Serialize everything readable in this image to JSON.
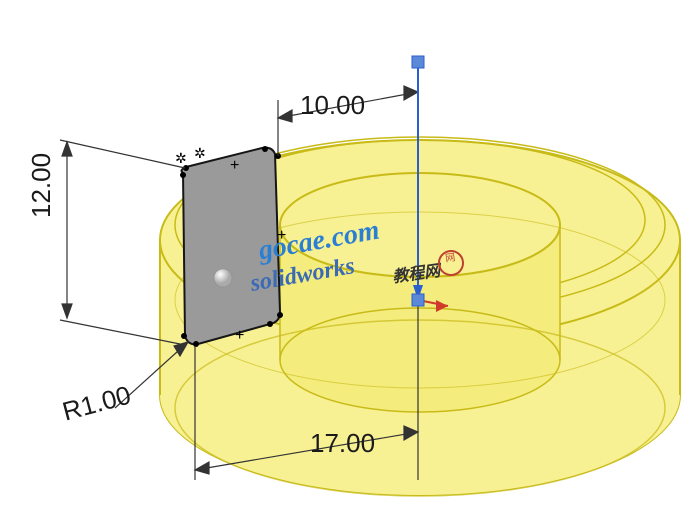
{
  "dimensions": {
    "width_top": "10.00",
    "height": "12.00",
    "radius": "R1.00",
    "width_bottom": "17.00"
  },
  "watermark": {
    "url": "gocae.com",
    "product": "solidworks",
    "cn": "教程网"
  },
  "colors": {
    "ring_fill": "#f8f193",
    "ring_edge": "#c8bb18",
    "sketch_fill": "#9a9a9a",
    "sketch_edge": "#161616",
    "dim_line": "#333333",
    "axis_blue": "#2a5fd0",
    "axis_red": "#d03a2a",
    "handle_fill": "#5b89d8"
  }
}
